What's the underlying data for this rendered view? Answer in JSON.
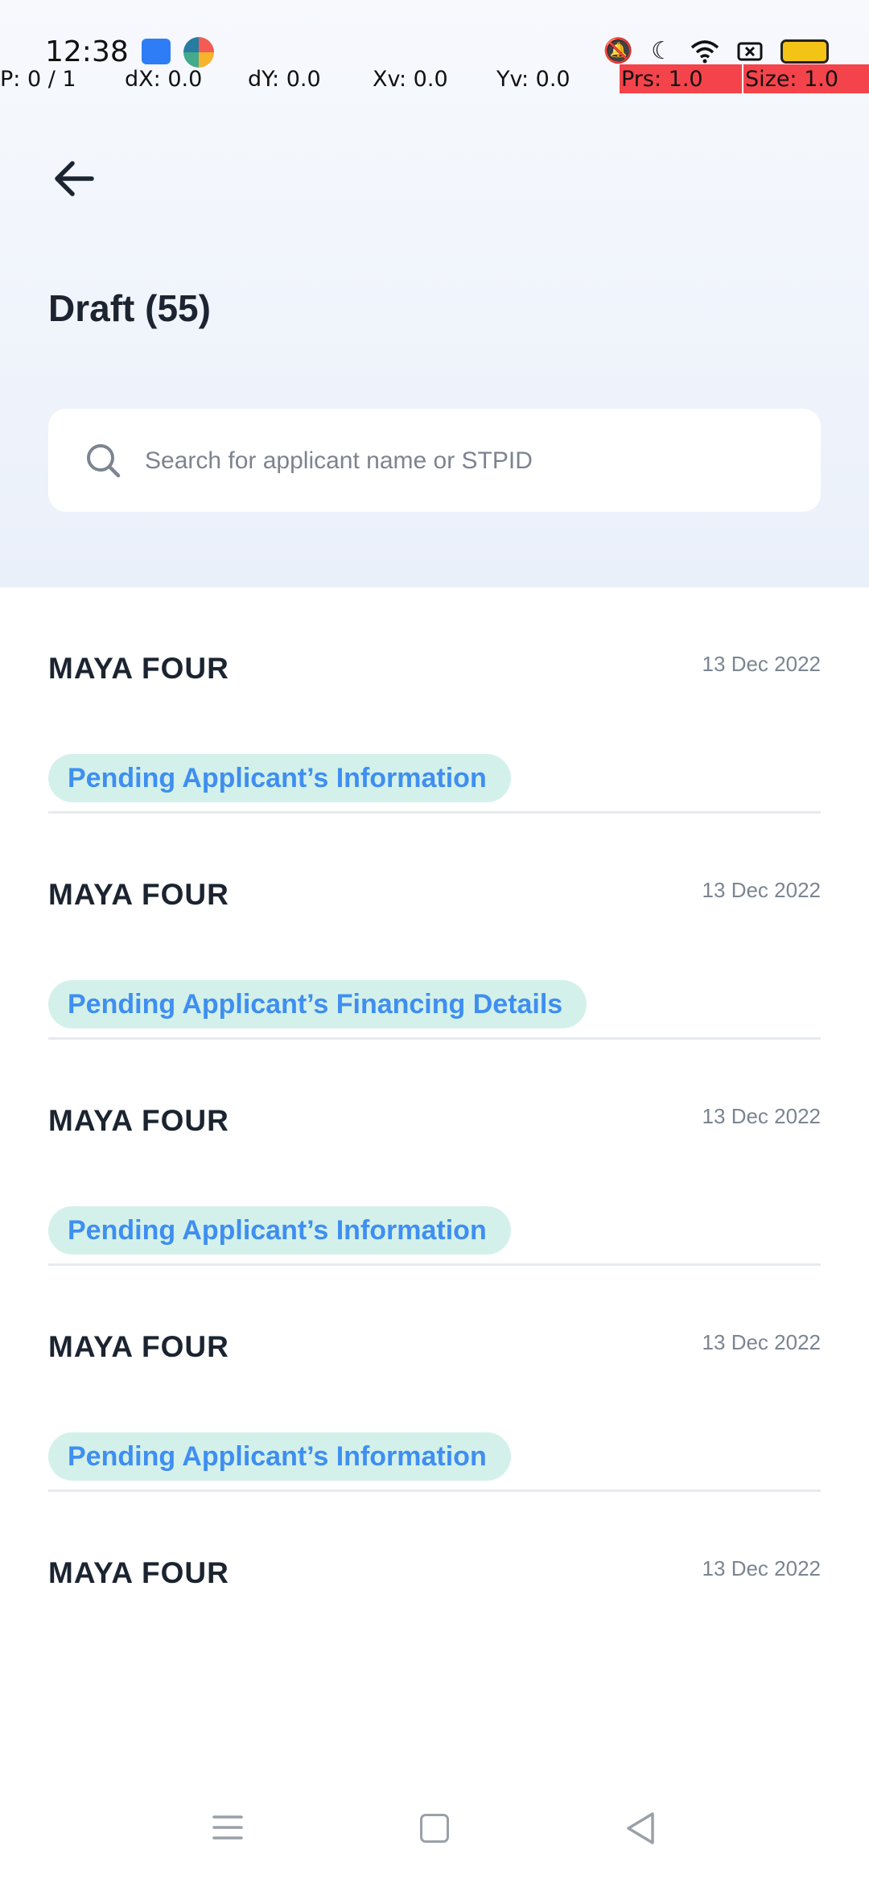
{
  "status_bar": {
    "time": "12:38",
    "icons": [
      "android-debug-icon",
      "browser-app-icon",
      "mute-icon",
      "moon-icon",
      "wifi-icon",
      "screen-record-icon",
      "battery-icon"
    ]
  },
  "debug_overlay": {
    "pointer": "P: 0 / 1",
    "dx": "dX: 0.0",
    "dy": "dY: 0.0",
    "xv": "Xv: 0.0",
    "yv": "Yv: 0.0",
    "prs": "Prs: 1.0",
    "size": "Size: 1.0"
  },
  "header": {
    "title": "Draft (55)"
  },
  "search": {
    "placeholder": "Search for applicant name or STPID",
    "value": ""
  },
  "drafts": [
    {
      "name": "MAYA FOUR",
      "date": "13 Dec 2022",
      "status": "Pending Applicant’s Information"
    },
    {
      "name": "MAYA FOUR",
      "date": "13 Dec 2022",
      "status": "Pending Applicant’s Financing Details"
    },
    {
      "name": "MAYA FOUR",
      "date": "13 Dec 2022",
      "status": "Pending Applicant’s Information"
    },
    {
      "name": "MAYA FOUR",
      "date": "13 Dec 2022",
      "status": "Pending Applicant’s Information"
    },
    {
      "name": "MAYA FOUR",
      "date": "13 Dec 2022",
      "status": ""
    }
  ],
  "colors": {
    "status_pill_bg": "#d3f1ea",
    "status_pill_text": "#3f8ef1",
    "header_bg": "#eaf0fa",
    "overlay_highlight": "#f4434a"
  }
}
